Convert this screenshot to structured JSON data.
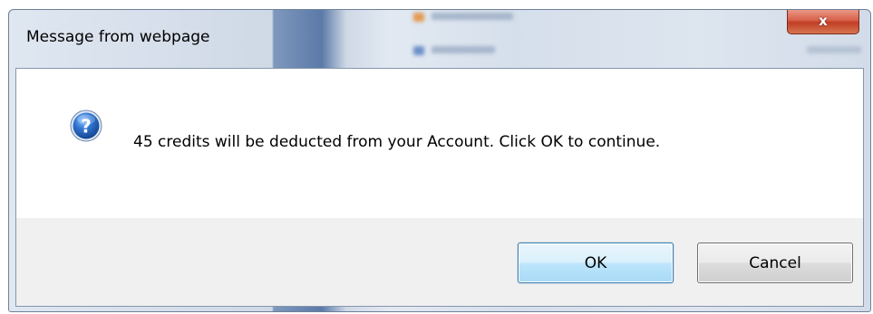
{
  "dialog": {
    "title": "Message from webpage",
    "close_glyph": "x",
    "close_icon": "close-icon",
    "message_icon": "question-icon",
    "message": "45 credits will be deducted from your Account. Click OK to continue.",
    "buttons": {
      "ok_label": "OK",
      "cancel_label": "Cancel"
    }
  },
  "colors": {
    "frame": "#cfd9e6",
    "close_button": "#c13e26",
    "button_area": "#f0f0f0",
    "default_button_border": "#3c7fb1",
    "icon_blue": "#1d5fb3"
  }
}
